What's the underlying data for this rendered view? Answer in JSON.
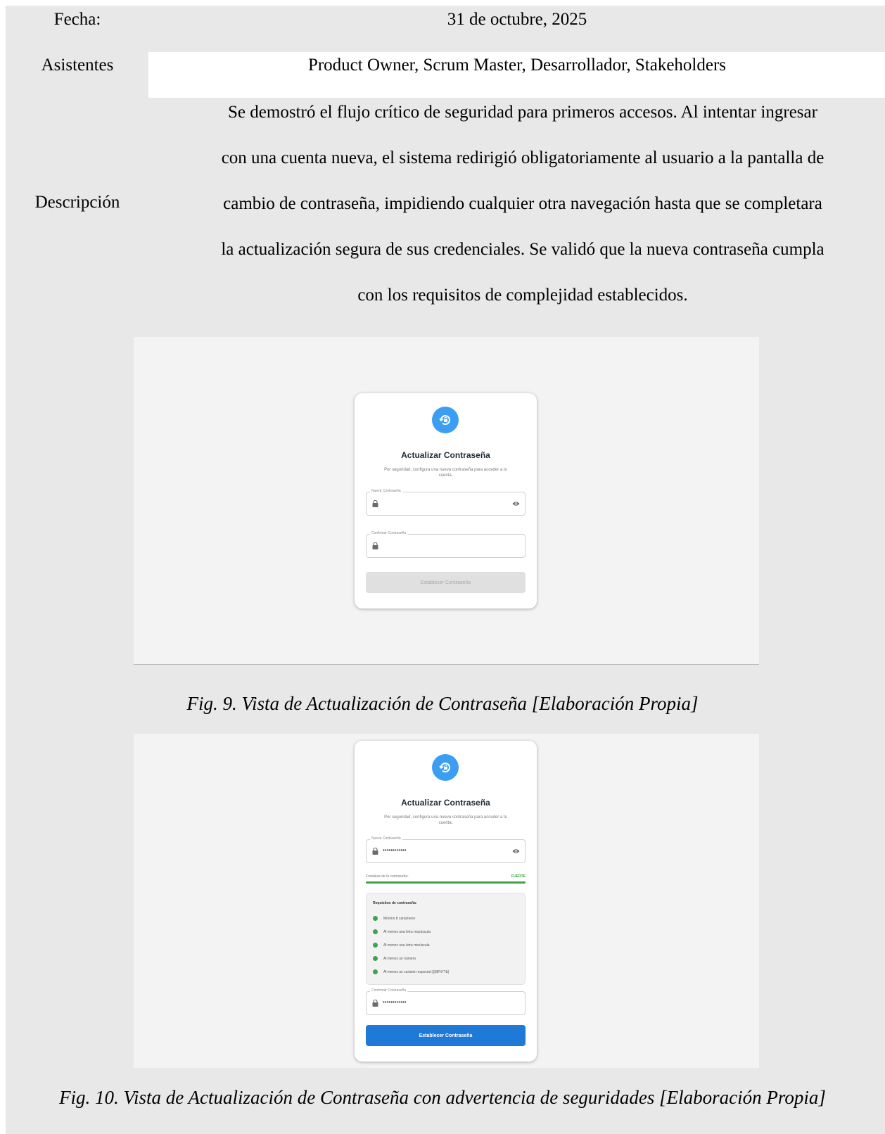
{
  "table": {
    "fecha_label": "Fecha:",
    "fecha_value": "31 de octubre, 2025",
    "asistentes_label": "Asistentes",
    "asistentes_value": "Product Owner, Scrum Master, Desarrollador, Stakeholders",
    "descripcion_label": "Descripción",
    "descripcion_lines": [
      "Se demostró el flujo crítico de seguridad para primeros accesos. Al intentar ingresar",
      "con una cuenta nueva, el sistema redirigió obligatoriamente al usuario a la pantalla de",
      "cambio de contraseña, impidiendo cualquier otra navegación hasta que se completara",
      "la actualización segura de sus credenciales. Se validó que la nueva contraseña cumpla",
      "con los requisitos de complejidad establecidos."
    ]
  },
  "figure9": {
    "card": {
      "icon": "lock-reset-icon",
      "title": "Actualizar Contraseña",
      "subtitle_line1": "Por seguridad, configura una nueva contraseña para acceder a tu",
      "subtitle_line2": "cuenta.",
      "new_password_label": "Nueva Contraseña",
      "new_password_value": "",
      "confirm_password_label": "Confirmar Contraseña",
      "confirm_password_value": "",
      "button_label": "Establecer Contraseña",
      "button_state": "disabled"
    },
    "caption": "Fig. 9. Vista de Actualización de Contraseña [Elaboración Propia]"
  },
  "figure10": {
    "card": {
      "icon": "lock-reset-icon",
      "title": "Actualizar Contraseña",
      "subtitle_line1": "Por seguridad, configura una nueva contraseña para acceder a tu",
      "subtitle_line2": "cuenta.",
      "new_password_label": "Nueva Contraseña",
      "new_password_value": "••••••••••••",
      "strength_label": "Fortaleza de la contraseña:",
      "strength_value": "FUERTE",
      "strength_level": 1.0,
      "requirements_title": "Requisitos de contraseña:",
      "requirements": [
        "Mínimo 8 caracteres",
        "Al menos una letra mayúscula",
        "Al menos una letra minúscula",
        "Al menos un número",
        "Al menos un carácter especial (@$!%*?&)"
      ],
      "confirm_password_label": "Confirmar Contraseña",
      "confirm_password_value": "••••••••••••",
      "button_label": "Establecer Contraseña",
      "button_state": "enabled"
    },
    "caption": "Fig. 10. Vista de Actualización de Contraseña con advertencia de seguridades [Elaboración Propia]"
  },
  "colors": {
    "accent": "#3b9ef2",
    "primary_button": "#1e7ad6",
    "success": "#43a047",
    "table_background": "#e8e8e8"
  }
}
